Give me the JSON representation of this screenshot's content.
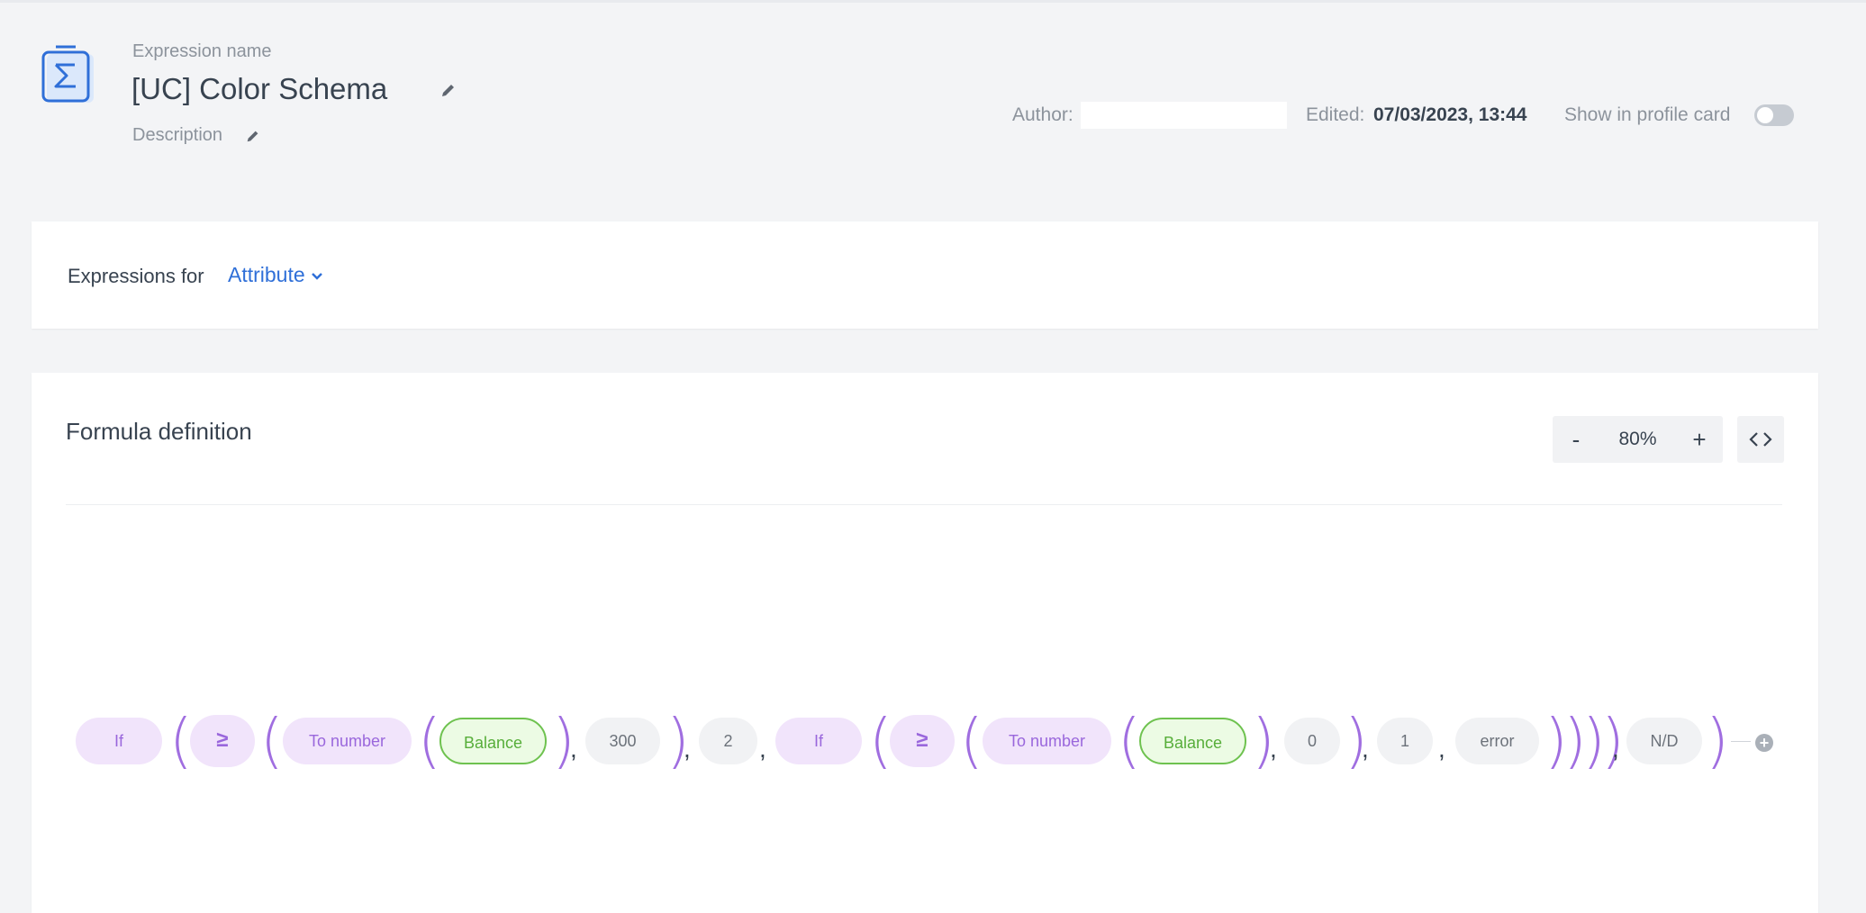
{
  "header": {
    "expression_caption": "Expression name",
    "expression_name": "[UC] Color Schema",
    "description": "Description",
    "author_label": "Author:",
    "edited_label": "Edited:",
    "edited_value": "07/03/2023, 13:44",
    "show_in_profile_label": "Show in profile card",
    "show_in_profile_on": false
  },
  "expressions_for": {
    "label": "Expressions for",
    "selected": "Attribute"
  },
  "formula": {
    "title": "Formula definition",
    "zoom_minus": "-",
    "zoom_value": "80%",
    "zoom_plus": "+",
    "tokens": {
      "if1": "If",
      "gte1": "≥",
      "tonum1": "To number",
      "balance1": "Balance",
      "v300": "300",
      "v2": "2",
      "if2": "If",
      "gte2": "≥",
      "tonum2": "To number",
      "balance2": "Balance",
      "v0": "0",
      "v1": "1",
      "error": "error",
      "nd": "N/D"
    },
    "paren_open": "(",
    "paren_close": ")",
    "comma": ","
  },
  "colors": {
    "accent_blue": "#2f6fd8",
    "function_purple": "#9a67dc",
    "attribute_green": "#57ae3a"
  }
}
